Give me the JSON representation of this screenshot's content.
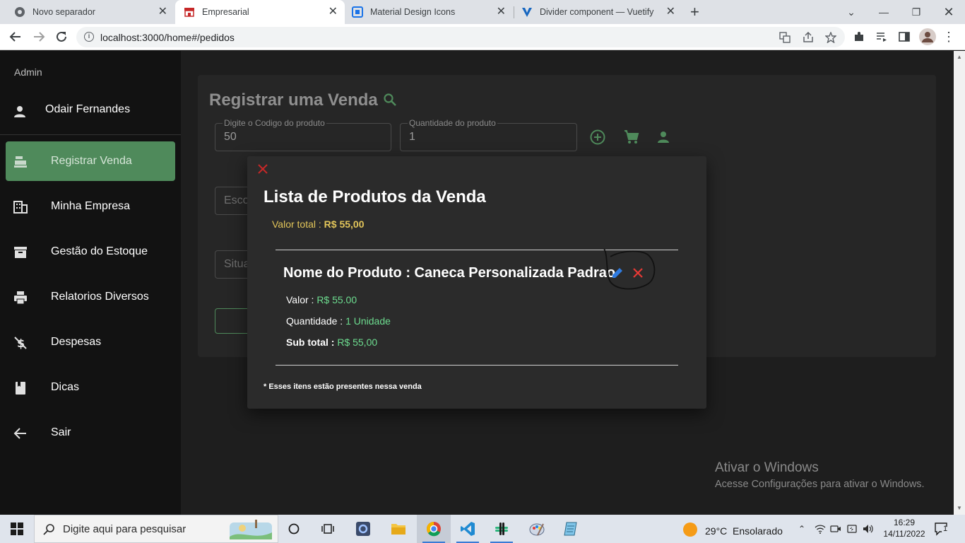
{
  "browser": {
    "tabs": [
      {
        "title": "Novo separador",
        "active": false,
        "icon": "chrome-icon"
      },
      {
        "title": "Empresarial",
        "active": true,
        "icon": "store-icon"
      },
      {
        "title": "Material Design Icons",
        "active": false,
        "icon": "mdi-icon"
      },
      {
        "title": "Divider component — Vuetify",
        "active": false,
        "icon": "vuetify-icon"
      }
    ],
    "url": "localhost:3000/home#/pedidos"
  },
  "sidebar": {
    "admin_label": "Admin",
    "user_name": "Odair Fernandes",
    "items": [
      {
        "label": "Registrar Venda",
        "icon": "cash-register-icon",
        "active": true
      },
      {
        "label": "Minha Empresa",
        "icon": "office-building-icon",
        "active": false
      },
      {
        "label": "Gestão do Estoque",
        "icon": "archive-icon",
        "active": false
      },
      {
        "label": "Relatorios Diversos",
        "icon": "printer-icon",
        "active": false
      },
      {
        "label": "Despesas",
        "icon": "currency-off-icon",
        "active": false
      },
      {
        "label": "Dicas",
        "icon": "bookmark-book-icon",
        "active": false
      },
      {
        "label": "Sair",
        "icon": "arrow-left-icon",
        "active": false
      }
    ]
  },
  "main": {
    "title": "Registrar uma Venda",
    "product_code": {
      "label": "Digite o Codigo do produto",
      "value": "50"
    },
    "quantity": {
      "label": "Quantidade do produto",
      "value": "1"
    },
    "select_partial_1": "Esco",
    "select_partial_2": "Situa"
  },
  "dialog": {
    "title": "Lista de Produtos da Venda",
    "total_label": "Valor total : ",
    "total_value": "R$ 55,00",
    "product": {
      "name": "Nome do Produto : Caneca Personalizada Padrao",
      "value_label": "Valor : ",
      "value": "R$ 55.00",
      "qty_label": "Quantidade : ",
      "qty": "1 Unidade",
      "subtotal_label": "Sub total : ",
      "subtotal": "R$ 55,00"
    },
    "footnote": "* Esses itens estão presentes nessa venda"
  },
  "watermark": {
    "line1": "Ativar o Windows",
    "line2": "Acesse Configurações para ativar o Windows."
  },
  "taskbar": {
    "search_placeholder": "Digite aqui para pesquisar",
    "weather": "29°C  Ensolarado",
    "time": "16:29",
    "date": "14/11/2022",
    "notifications": "1"
  },
  "colors": {
    "accent_green": "#4f8a5b",
    "value_green": "#6ddc8f",
    "total_yellow": "#e2c55a",
    "delete_red": "#e53935",
    "edit_blue": "#2f7be0"
  }
}
